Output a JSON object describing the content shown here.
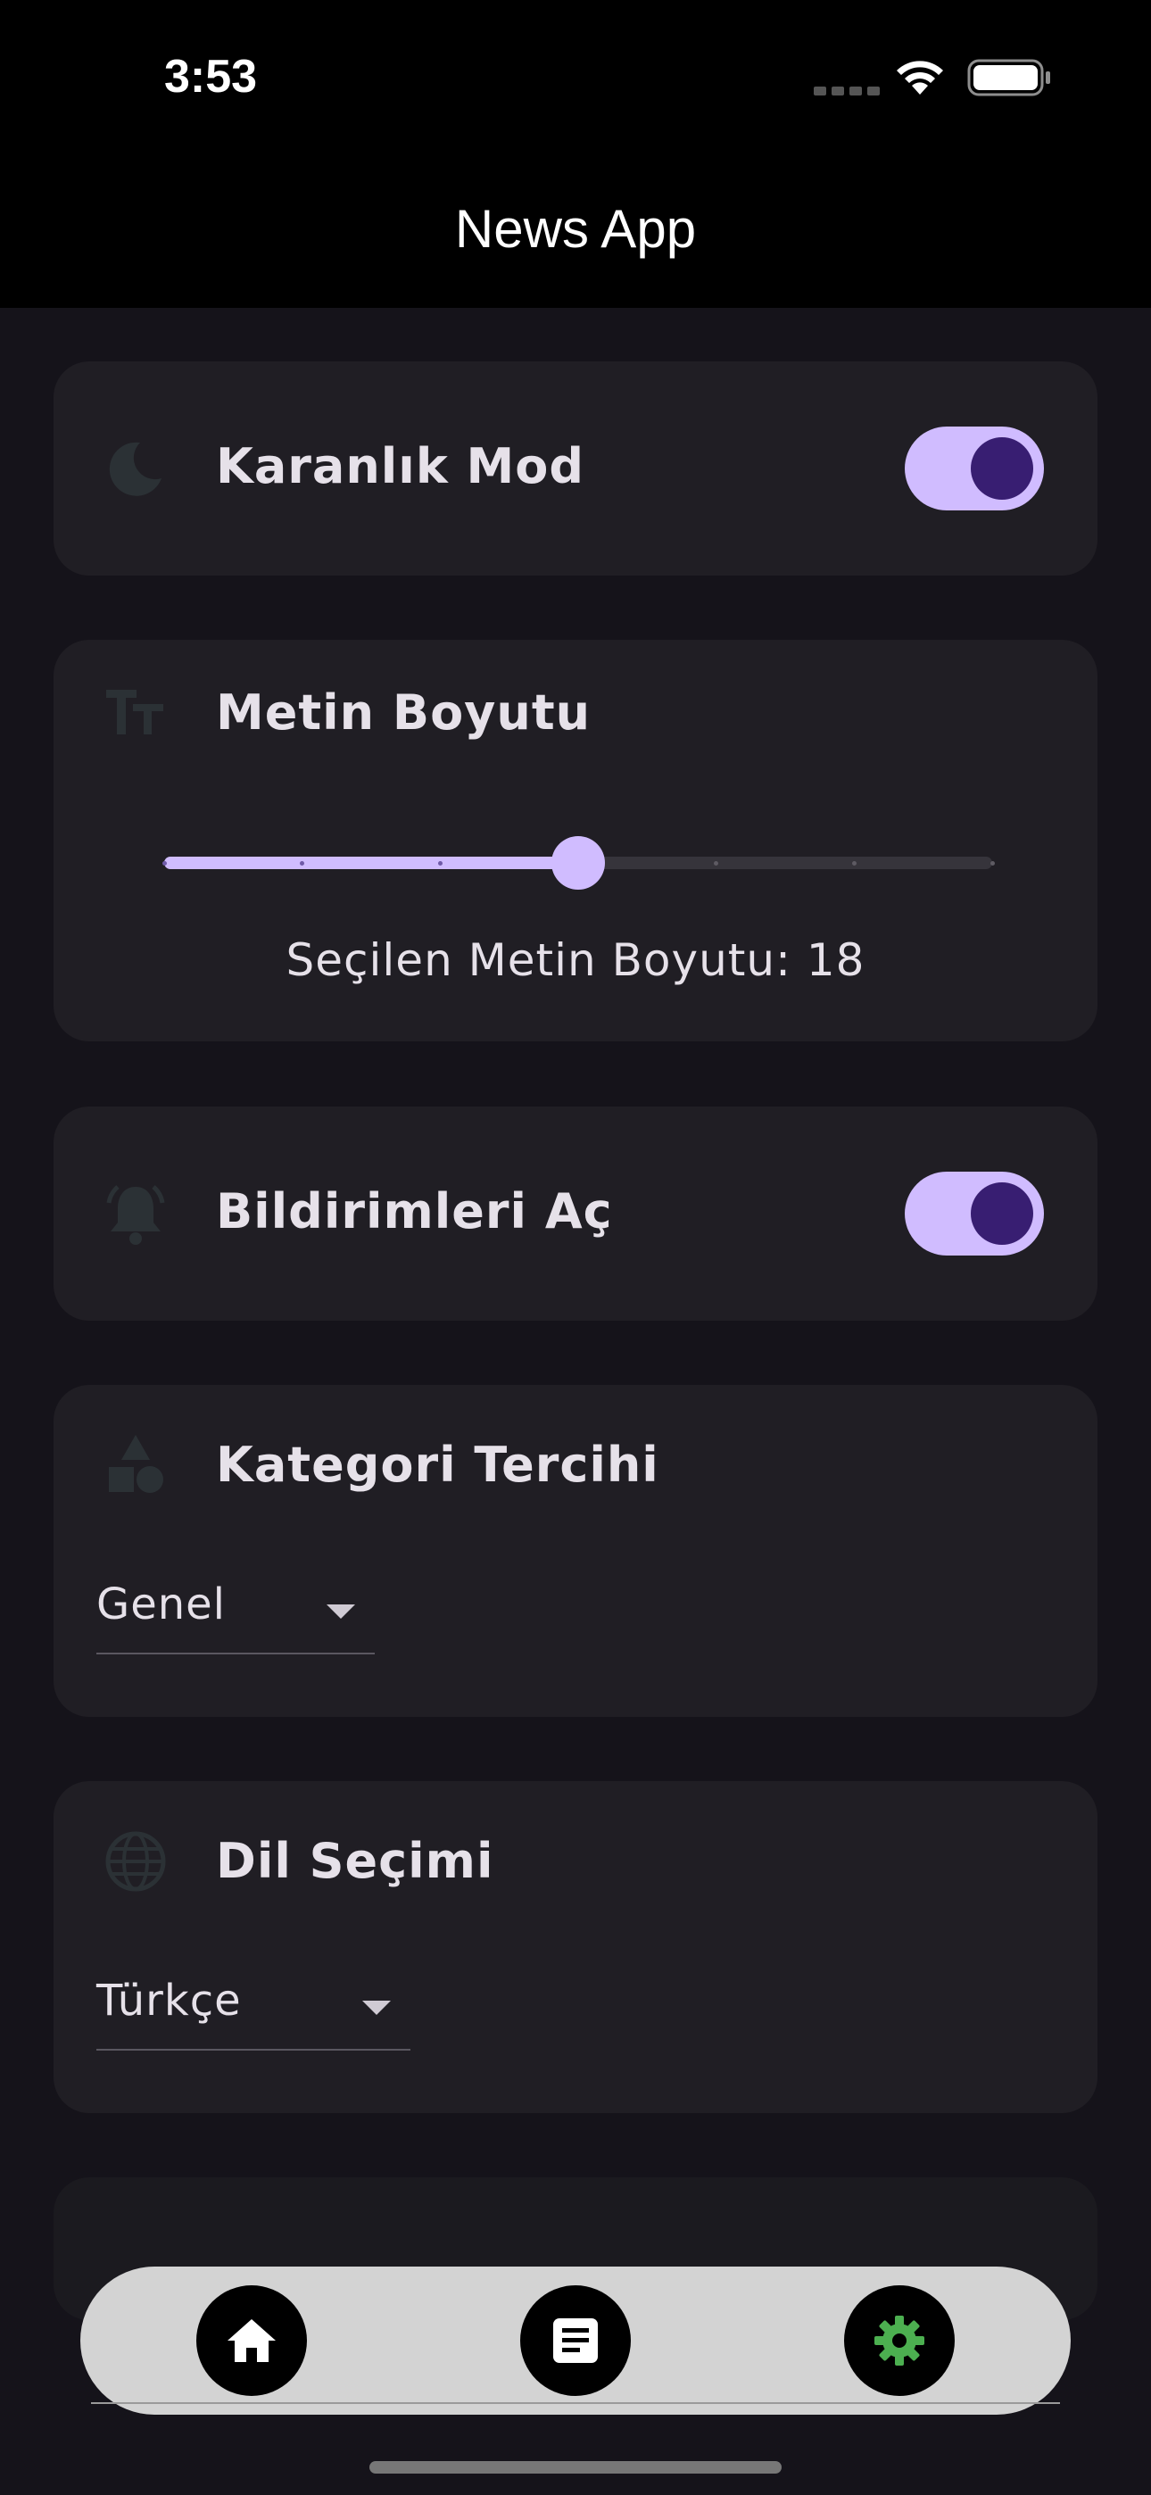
{
  "status_bar": {
    "time": "3:53"
  },
  "app_bar": {
    "title": "News App"
  },
  "dark_mode": {
    "label": "Karanlık Mod",
    "enabled": true,
    "icon": "moon-icon"
  },
  "text_size": {
    "label": "Metin Boyutu",
    "icon": "text-size-icon",
    "value_text": "Seçilen Metin Boyutu: 18",
    "value": 18,
    "min": 12,
    "max": 24,
    "divisions": 6
  },
  "notifications": {
    "label": "Bildirimleri Aç",
    "enabled": true,
    "icon": "bell-icon"
  },
  "category": {
    "label": "Kategori Tercihi",
    "icon": "category-shapes-icon",
    "selected": "Genel"
  },
  "language": {
    "label": "Dil Seçimi",
    "icon": "globe-icon",
    "selected": "Türkçe"
  },
  "bottom_nav": {
    "items": [
      {
        "icon": "home-icon",
        "color": "#ffffff"
      },
      {
        "icon": "article-icon",
        "color": "#ffffff"
      },
      {
        "icon": "gear-icon",
        "color": "#4caf50",
        "active": true
      }
    ]
  },
  "colors": {
    "accent": "#d0bcff",
    "knob": "#381e72",
    "card": "#201e24",
    "background": "#15131a",
    "icon_muted": "#2b3135"
  }
}
